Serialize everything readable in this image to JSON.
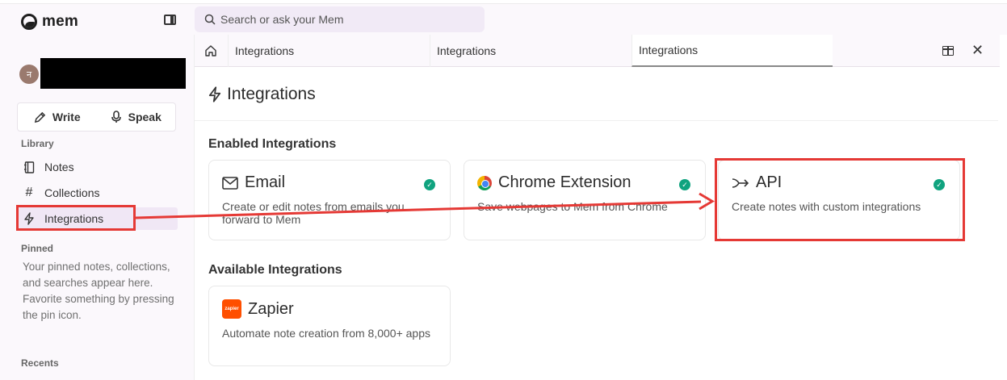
{
  "app": {
    "name": "mem"
  },
  "sidebar": {
    "avatar_initial": "न",
    "write_label": "Write",
    "speak_label": "Speak",
    "library_label": "Library",
    "items": [
      {
        "label": "Notes",
        "icon": "notebook-icon"
      },
      {
        "label": "Collections",
        "icon": "hash-icon"
      },
      {
        "label": "Integrations",
        "icon": "bolt-icon"
      }
    ],
    "pinned_label": "Pinned",
    "pinned_text": "Your pinned notes, collections, and searches appear here. Favorite something by pressing the pin icon.",
    "recents_label": "Recents"
  },
  "search": {
    "placeholder": "Search or ask your Mem"
  },
  "tabs": [
    "Integrations",
    "Integrations",
    "Integrations"
  ],
  "page": {
    "title": "Integrations",
    "enabled_title": "Enabled Integrations",
    "available_title": "Available Integrations",
    "enabled": [
      {
        "name": "Email",
        "desc": "Create or edit notes from emails you forward to Mem"
      },
      {
        "name": "Chrome Extension",
        "desc": "Save webpages to Mem from Chrome"
      },
      {
        "name": "API",
        "desc": "Create notes with custom integrations"
      }
    ],
    "available": [
      {
        "name": "Zapier",
        "desc": "Automate note creation from 8,000+ apps",
        "logo_text": "zapier"
      }
    ]
  },
  "colors": {
    "accent": "#f0e7f5",
    "check": "#10a37f",
    "annotation": "#e53935",
    "zapier": "#ff4f00"
  }
}
